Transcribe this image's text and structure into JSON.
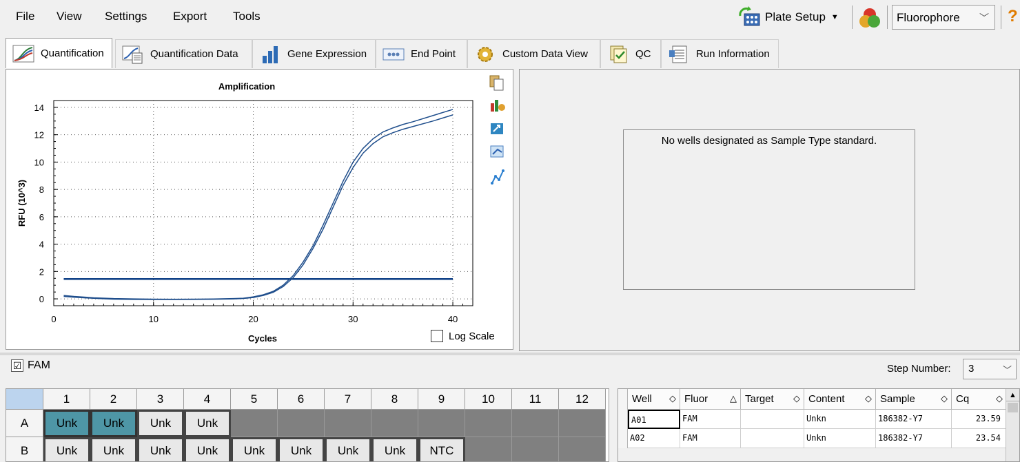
{
  "menu": {
    "file": "File",
    "view": "View",
    "settings": "Settings",
    "export": "Export",
    "tools": "Tools"
  },
  "toolbar": {
    "plate_setup": "Plate Setup",
    "fluorophore": "Fluorophore",
    "help": "?"
  },
  "tabs": [
    "Quantification",
    "Quantification Data",
    "Gene Expression",
    "End Point",
    "Custom Data View",
    "QC",
    "Run Information"
  ],
  "chart": {
    "title": "Amplification",
    "xlabel": "Cycles",
    "ylabel": "RFU (10^3)",
    "log_scale_label": "Log Scale"
  },
  "chart_data": {
    "type": "line",
    "title": "Amplification",
    "xlabel": "Cycles",
    "ylabel": "RFU (10^3)",
    "xlim": [
      0,
      42
    ],
    "ylim": [
      -0.5,
      14.5
    ],
    "xticks": [
      0,
      10,
      20,
      30,
      40
    ],
    "yticks": [
      0,
      2,
      4,
      6,
      8,
      10,
      12,
      14
    ],
    "grid": true,
    "threshold": 1.45,
    "series": [
      {
        "x": [
          1,
          2,
          4,
          6,
          8,
          10,
          12,
          14,
          16,
          18,
          19,
          20,
          21,
          22,
          23,
          24,
          25,
          26,
          27,
          28,
          29,
          30,
          31,
          32,
          33,
          34,
          35,
          36,
          38,
          40
        ],
        "y": [
          0.25,
          0.18,
          0.08,
          0.02,
          0,
          -0.02,
          -0.03,
          -0.02,
          -0.01,
          0.02,
          0.05,
          0.15,
          0.3,
          0.55,
          1.0,
          1.7,
          2.7,
          3.9,
          5.4,
          7.0,
          8.6,
          10.0,
          11.0,
          11.7,
          12.2,
          12.5,
          12.75,
          12.95,
          13.4,
          13.85
        ]
      },
      {
        "x": [
          1,
          2,
          4,
          6,
          8,
          10,
          12,
          14,
          16,
          18,
          19,
          20,
          21,
          22,
          23,
          24,
          25,
          26,
          27,
          28,
          29,
          30,
          31,
          32,
          33,
          34,
          35,
          36,
          38,
          40
        ],
        "y": [
          0.18,
          0.12,
          0.04,
          -0.02,
          -0.04,
          -0.05,
          -0.05,
          -0.04,
          -0.03,
          0,
          0.03,
          0.1,
          0.25,
          0.48,
          0.9,
          1.55,
          2.5,
          3.7,
          5.1,
          6.7,
          8.3,
          9.6,
          10.65,
          11.35,
          11.85,
          12.15,
          12.4,
          12.6,
          13.0,
          13.45
        ]
      }
    ]
  },
  "standard_curve": {
    "message": "No wells designated as Sample Type standard."
  },
  "fluor_filter": {
    "label": "FAM",
    "checked": "☑"
  },
  "step": {
    "label": "Step Number:",
    "value": "3"
  },
  "plate": {
    "columns": [
      "1",
      "2",
      "3",
      "4",
      "5",
      "6",
      "7",
      "8",
      "9",
      "10",
      "11",
      "12"
    ],
    "rows": [
      {
        "label": "A",
        "wells": [
          "Unk",
          "Unk",
          "Unk",
          "Unk",
          "",
          "",
          "",
          "",
          "",
          "",
          "",
          ""
        ]
      },
      {
        "label": "B",
        "wells": [
          "Unk",
          "Unk",
          "Unk",
          "Unk",
          "Unk",
          "Unk",
          "Unk",
          "Unk",
          "NTC",
          "",
          "",
          ""
        ]
      }
    ]
  },
  "results": {
    "headers": [
      "Well",
      "Fluor",
      "Target",
      "Content",
      "Sample",
      "Cq"
    ],
    "rows": [
      [
        "A01",
        "FAM",
        "",
        "Unkn",
        "186382-Y7",
        "23.59"
      ],
      [
        "A02",
        "FAM",
        "",
        "Unkn",
        "186382-Y7",
        "23.54"
      ]
    ]
  },
  "colors": {
    "curve": "#1f4e8c",
    "threshold": "#0d3f86",
    "selected_well": "#4e96a6"
  }
}
